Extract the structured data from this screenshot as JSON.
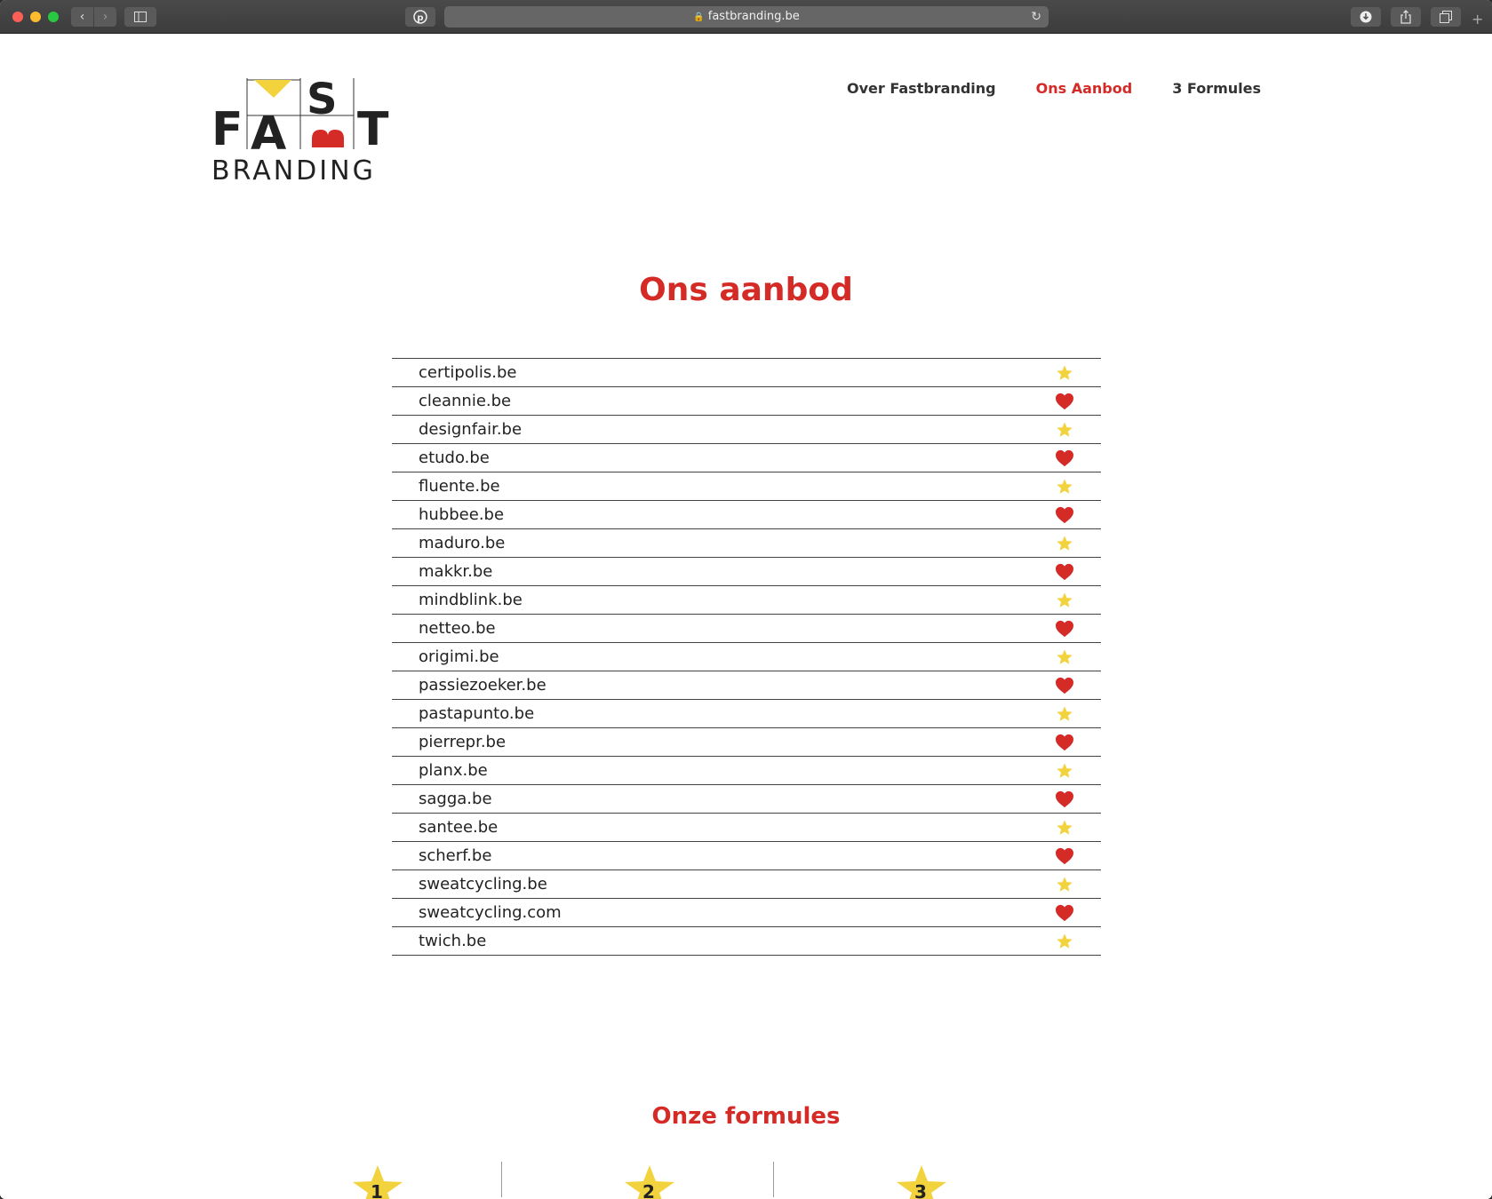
{
  "browser": {
    "url": "fastbranding.be"
  },
  "logo": {
    "text_top": "FAST",
    "text_bottom": "BRANDING"
  },
  "nav": {
    "items": [
      {
        "label": "Over Fastbranding",
        "active": false
      },
      {
        "label": "Ons Aanbod",
        "active": true
      },
      {
        "label": "3 Formules",
        "active": false
      }
    ]
  },
  "main": {
    "title": "Ons aanbod",
    "domains": [
      {
        "name": "certipolis.be",
        "icon": "star-icon"
      },
      {
        "name": "cleannie.be",
        "icon": "heart-icon"
      },
      {
        "name": "designfair.be",
        "icon": "star-icon"
      },
      {
        "name": "etudo.be",
        "icon": "heart-icon"
      },
      {
        "name": "fluente.be",
        "icon": "star-icon"
      },
      {
        "name": "hubbee.be",
        "icon": "heart-icon"
      },
      {
        "name": "maduro.be",
        "icon": "star-icon"
      },
      {
        "name": "makkr.be",
        "icon": "heart-icon"
      },
      {
        "name": "mindblink.be",
        "icon": "star-icon"
      },
      {
        "name": "netteo.be",
        "icon": "heart-icon"
      },
      {
        "name": "origimi.be",
        "icon": "star-icon"
      },
      {
        "name": "passiezoeker.be",
        "icon": "heart-icon"
      },
      {
        "name": "pastapunto.be",
        "icon": "star-icon"
      },
      {
        "name": "pierrepr.be",
        "icon": "heart-icon"
      },
      {
        "name": "planx.be",
        "icon": "star-icon"
      },
      {
        "name": "sagga.be",
        "icon": "heart-icon"
      },
      {
        "name": "santee.be",
        "icon": "star-icon"
      },
      {
        "name": "scherf.be",
        "icon": "heart-icon"
      },
      {
        "name": "sweatcycling.be",
        "icon": "star-icon"
      },
      {
        "name": "sweatcycling.com",
        "icon": "heart-icon"
      },
      {
        "name": "twich.be",
        "icon": "star-icon"
      }
    ]
  },
  "formules": {
    "title": "Onze formules",
    "items": [
      {
        "number": "1"
      },
      {
        "number": "2"
      },
      {
        "number": "3"
      }
    ]
  },
  "colors": {
    "brand_red": "#d52b27",
    "star_yellow": "#f2d33e",
    "text_dark": "#222222"
  }
}
